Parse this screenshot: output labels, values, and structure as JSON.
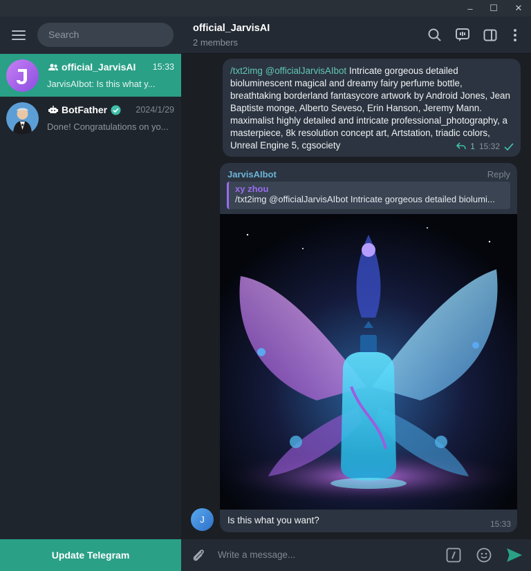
{
  "window": {
    "min": "–",
    "max": "☐",
    "close": "✕"
  },
  "sidebar": {
    "search_placeholder": "Search",
    "chats": [
      {
        "title": "official_JarvisAI",
        "time": "15:33",
        "preview": "JarvisAIbot: Is this what y...",
        "avatar_letter": "J"
      },
      {
        "title": "BotFather",
        "time": "2024/1/29",
        "preview": "Done! Congratulations on yo..."
      }
    ],
    "update_label": "Update Telegram"
  },
  "chat": {
    "title": "official_JarvisAI",
    "subtitle": "2 members"
  },
  "message1": {
    "command": "/txt2img @officialJarvisAIbot",
    "text": " Intricate gorgeous detailed bioluminescent magical and dreamy fairy perfume bottle, breathtaking borderland fantasycore artwork by Android Jones, Jean Baptiste monge, Alberto Seveso, Erin Hanson, Jeremy Mann. maximalist highly detailed and intricate professional_photography, a masterpiece, 8k resolution concept art, Artstation, triadic colors, Unreal Engine 5, cgsociety",
    "reply_count": "1",
    "time": "15:32"
  },
  "message2": {
    "author": "JarvisAIbot",
    "reply_label": "Reply",
    "quote_name": "xy zhou",
    "quote_text": "/txt2img @officialJarvisAIbot Intricate gorgeous detailed biolumi...",
    "caption": "Is this what you want?",
    "time": "15:33",
    "sender_letter": "J"
  },
  "composer": {
    "placeholder": "Write a message..."
  },
  "colors": {
    "accent": "#2aa087",
    "bubble": "#2b3440",
    "link": "#63c7b4"
  }
}
